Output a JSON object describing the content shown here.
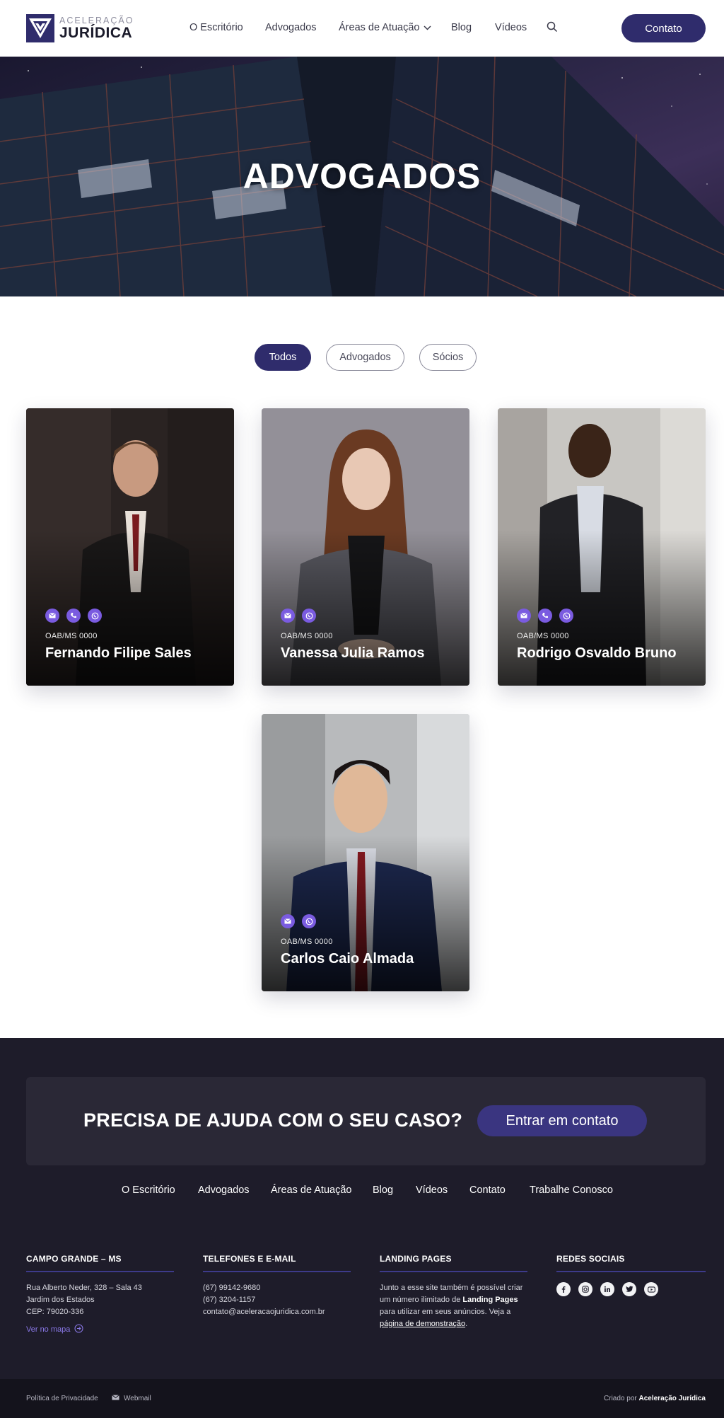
{
  "brand": {
    "line1": "ACELERAÇÃO",
    "line2": "JURÍDICA",
    "color": "#2f2c6c"
  },
  "nav": {
    "items": [
      "O Escritório",
      "Advogados",
      "Áreas de Atuação",
      "Blog",
      "Vídeos"
    ],
    "search_icon": "search-icon",
    "contact_label": "Contato"
  },
  "hero": {
    "title": "ADVOGADOS"
  },
  "filters": {
    "items": [
      "Todos",
      "Advogados",
      "Sócios"
    ],
    "active": "Todos"
  },
  "lawyers": [
    {
      "name": "Fernando Filipe Sales",
      "oab": "OAB/MS 0000",
      "icons": [
        "email-icon",
        "phone-icon",
        "whatsapp-icon"
      ]
    },
    {
      "name": "Vanessa Julia Ramos",
      "oab": "OAB/MS 0000",
      "icons": [
        "email-icon",
        "whatsapp-icon"
      ]
    },
    {
      "name": "Rodrigo Osvaldo Bruno",
      "oab": "OAB/MS 0000",
      "icons": [
        "email-icon",
        "phone-icon",
        "whatsapp-icon"
      ]
    },
    {
      "name": "Carlos Caio Almada",
      "oab": "OAB/MS 0000",
      "icons": [
        "email-icon",
        "whatsapp-icon"
      ]
    }
  ],
  "cta": {
    "title": "PRECISA DE AJUDA COM O SEU CASO?",
    "button": "Entrar em contato"
  },
  "footer_nav": [
    "O Escritório",
    "Advogados",
    "Áreas de Atuação",
    "Blog",
    "Vídeos",
    "Contato",
    "Trabalhe Conosco"
  ],
  "columns": {
    "address": {
      "title": "CAMPO GRANDE – MS",
      "line1": "Rua Alberto Neder, 328 – Sala 43",
      "line2": "Jardim dos Estados",
      "line3": "CEP: 79020-336",
      "map_link": "Ver no mapa"
    },
    "contacts": {
      "title": "TELEFONES E E-MAIL",
      "phone1": "(67) 99142-9680",
      "phone2": "(67) 3204-1157",
      "email": "contato@aceleracaojuridica.com.br"
    },
    "landing": {
      "title": "LANDING PAGES",
      "text_a": "Junto a esse site também é possível criar um número ilimitado de ",
      "bold": "Landing Pages",
      "text_b": " para utilizar em seus anúncios. Veja a ",
      "link": "página de demonstração",
      "text_c": "."
    },
    "social": {
      "title": "REDES SOCIAIS",
      "icons": [
        "facebook-icon",
        "instagram-icon",
        "linkedin-icon",
        "twitter-icon",
        "youtube-icon"
      ]
    }
  },
  "bottom": {
    "privacy": "Política de Privacidade",
    "webmail": "Webmail",
    "credit_prefix": "Criado por ",
    "credit_name": "Aceleração Jurídica"
  }
}
